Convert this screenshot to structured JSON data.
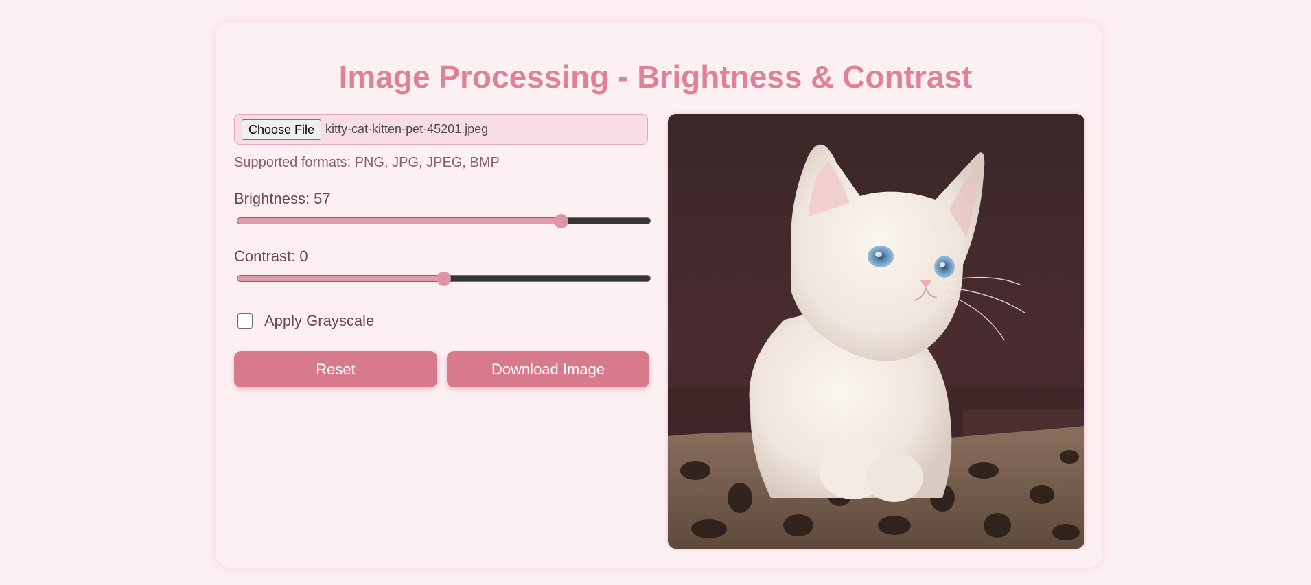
{
  "page": {
    "title": "Image Processing - Brightness & Contrast"
  },
  "file_input": {
    "button_label": "Choose File",
    "file_name": "kitty-cat-kitten-pet-45201.jpeg",
    "supported_formats": "Supported formats: PNG, JPG, JPEG, BMP"
  },
  "brightness": {
    "label": "Brightness: 57",
    "value": 57,
    "min": -100,
    "max": 100
  },
  "contrast": {
    "label": "Contrast: 0",
    "value": 0,
    "min": -100,
    "max": 100
  },
  "grayscale": {
    "label": "Apply Grayscale",
    "checked": false
  },
  "buttons": {
    "reset_label": "Reset",
    "download_label": "Download Image"
  },
  "preview": {
    "subject": "white kitten on leopard-print cushion"
  },
  "colors": {
    "accent": "#e0819a",
    "button": "#d77b8c",
    "background": "#fdf0f3"
  }
}
